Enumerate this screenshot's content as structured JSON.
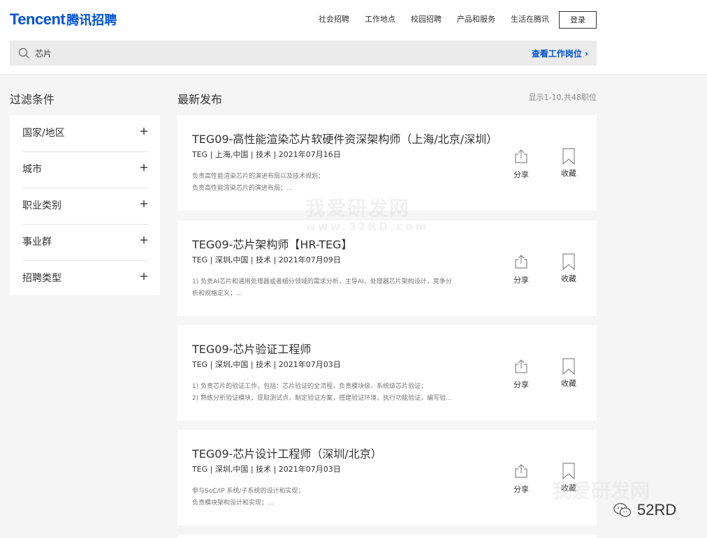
{
  "header": {
    "logo_en": "Tencent",
    "logo_cn": "腾讯招聘",
    "nav": [
      "社会招聘",
      "工作地点",
      "校园招聘",
      "产品和服务",
      "生活在腾讯"
    ],
    "login_label": "登录"
  },
  "search": {
    "value": "芯片",
    "view_jobs_label": "查看工作岗位 ›"
  },
  "sidebar": {
    "title": "过滤条件",
    "filters": [
      "国家/地区",
      "城市",
      "职业类别",
      "事业群",
      "招聘类型"
    ]
  },
  "main": {
    "title": "最新发布",
    "count_text": "显示1-10,共48职位",
    "share_label": "分享",
    "fav_label": "收藏",
    "jobs": [
      {
        "title": "TEG09-高性能渲染芯片软硬件资深架构师（上海/北京/深圳）",
        "meta": "TEG | 上海,中国 | 技术 | 2021年07月16日",
        "desc": [
          "负责高性能渲染芯片的演进布局以及技术规划；",
          "负责高性能渲染芯片的演进布局；..."
        ]
      },
      {
        "title": "TEG09-芯片架构师【HR-TEG】",
        "meta": "TEG | 深圳,中国 | 技术 | 2021年07月09日",
        "desc": [
          "1) 负责AI芯片和通用处理器或者细分领域的需求分析，主导AI，处理器芯片架构设计，竞争分",
          "析和规格定义；..."
        ]
      },
      {
        "title": "TEG09-芯片验证工程师",
        "meta": "TEG | 深圳,中国 | 技术 | 2021年07月03日",
        "desc": [
          "1) 负责芯片的验证工作，包括：芯片验证的全流程，负责模块级、系统级芯片验证；",
          "2) 熟练分析验证模块，提取测试点，制定验证方案，搭建验证环境，执行功能验证，编写验..."
        ]
      },
      {
        "title": "TEG09-芯片设计工程师（深圳/北京）",
        "meta": "TEG | 深圳,中国 | 技术 | 2021年07月03日",
        "desc": [
          "参与SoC/IP 系统/子系统的设计和实现；",
          "负责模块架构设计和实现；..."
        ]
      }
    ]
  },
  "watermark": {
    "main": "我爱研发网",
    "url": "www.52RD.com",
    "corner": "我爱研发网",
    "brand": "52RD"
  }
}
